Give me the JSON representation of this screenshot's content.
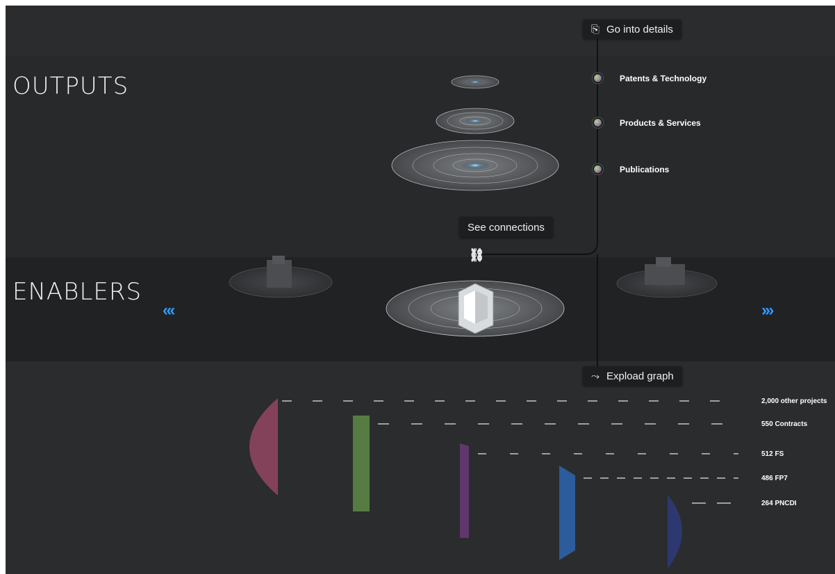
{
  "toolbar": {
    "go_into_details": "Go into details",
    "see_connections": "See connections",
    "expload_graph": "Expload graph"
  },
  "sections": {
    "outputs": "OUTPUTS",
    "enablers": "ENABLERS"
  },
  "outputs_legend": [
    {
      "label": "Patents & Technology"
    },
    {
      "label": "Products & Services"
    },
    {
      "label": "Publications"
    }
  ],
  "navigation": {
    "prev_icon": "«‹",
    "next_icon": "›»"
  },
  "funding_graph": [
    {
      "label": "2,000  other projects",
      "color": "#a24a68"
    },
    {
      "label": "550 Contracts",
      "color": "#5e8a46"
    },
    {
      "label": "512 FS",
      "color": "#6a3a78"
    },
    {
      "label": "486 FP7",
      "color": "#2c62a8"
    },
    {
      "label": "264 PNCDI",
      "color": "#2d3a78"
    }
  ],
  "colors": {
    "background": "#2a2b2d",
    "accent_blue": "#2e9cff"
  },
  "icons": [
    "details-icon",
    "connections-icon",
    "expload-icon",
    "chevron-left-icon",
    "chevron-right-icon"
  ]
}
